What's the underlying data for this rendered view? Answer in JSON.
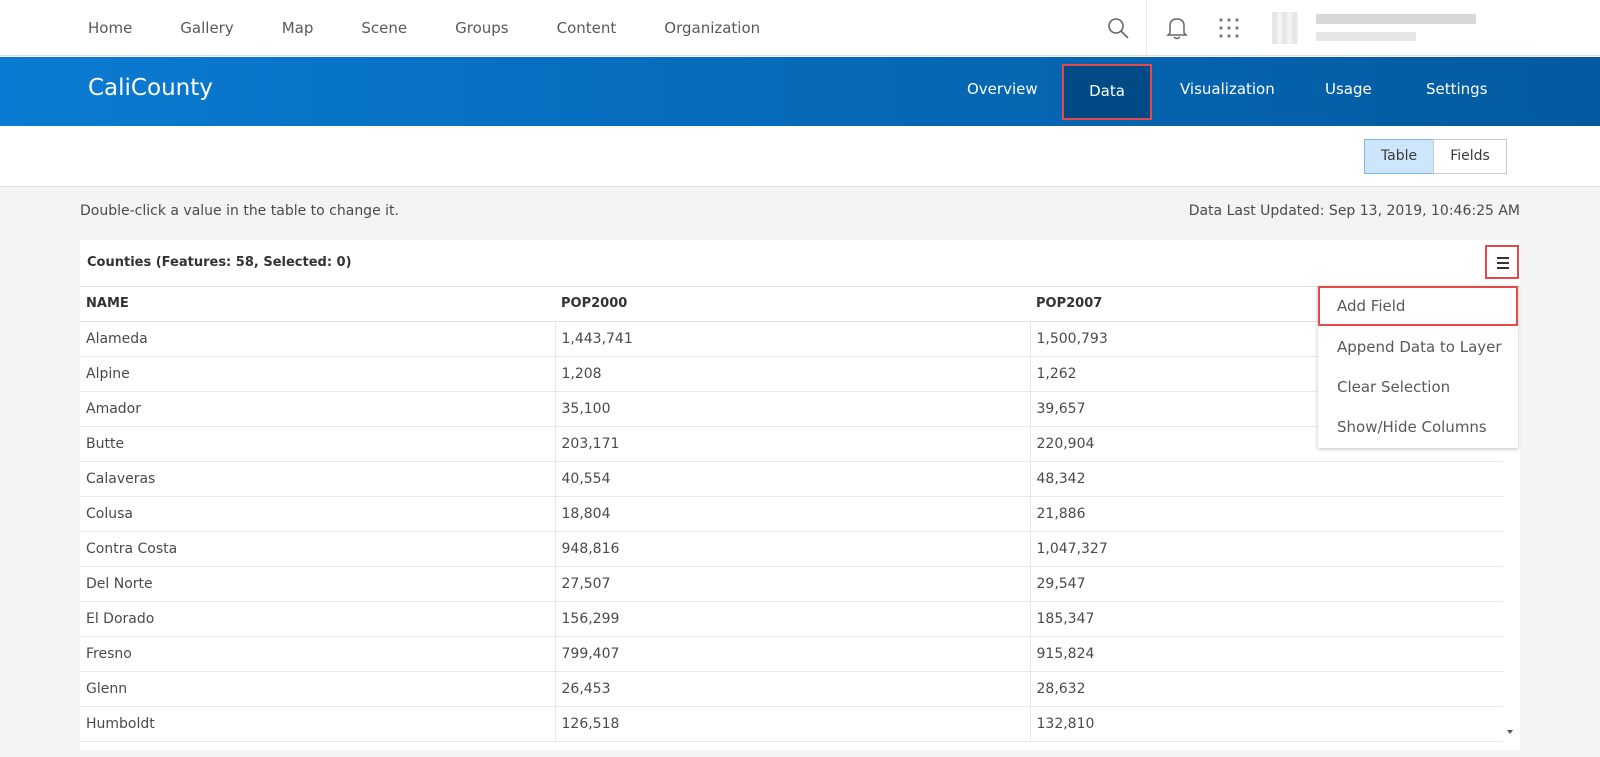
{
  "topnav": {
    "links": [
      "Home",
      "Gallery",
      "Map",
      "Scene",
      "Groups",
      "Content",
      "Organization"
    ]
  },
  "item": {
    "title": "CaliCounty",
    "tabs": {
      "overview": "Overview",
      "data": "Data",
      "visualization": "Visualization",
      "usage": "Usage",
      "settings": "Settings"
    }
  },
  "view_toggle": {
    "table": "Table",
    "fields": "Fields"
  },
  "hint": "Double-click a value in the table to change it.",
  "last_updated": "Data Last Updated: Sep 13, 2019, 10:46:25 AM",
  "layer": {
    "title": "Counties (Features: 58, Selected: 0)"
  },
  "table": {
    "columns": [
      "NAME",
      "POP2000",
      "POP2007"
    ],
    "rows": [
      [
        "Alameda",
        "1,443,741",
        "1,500,793"
      ],
      [
        "Alpine",
        "1,208",
        "1,262"
      ],
      [
        "Amador",
        "35,100",
        "39,657"
      ],
      [
        "Butte",
        "203,171",
        "220,904"
      ],
      [
        "Calaveras",
        "40,554",
        "48,342"
      ],
      [
        "Colusa",
        "18,804",
        "21,886"
      ],
      [
        "Contra Costa",
        "948,816",
        "1,047,327"
      ],
      [
        "Del Norte",
        "27,507",
        "29,547"
      ],
      [
        "El Dorado",
        "156,299",
        "185,347"
      ],
      [
        "Fresno",
        "799,407",
        "915,824"
      ],
      [
        "Glenn",
        "26,453",
        "28,632"
      ],
      [
        "Humboldt",
        "126,518",
        "132,810"
      ]
    ]
  },
  "menu": {
    "add_field": "Add Field",
    "append_data": "Append Data to Layer",
    "clear_selection": "Clear Selection",
    "show_hide": "Show/Hide Columns"
  },
  "colors": {
    "brand_blue": "#0567b4",
    "active_tab": "#004b85",
    "highlight": "#e34a4a"
  }
}
